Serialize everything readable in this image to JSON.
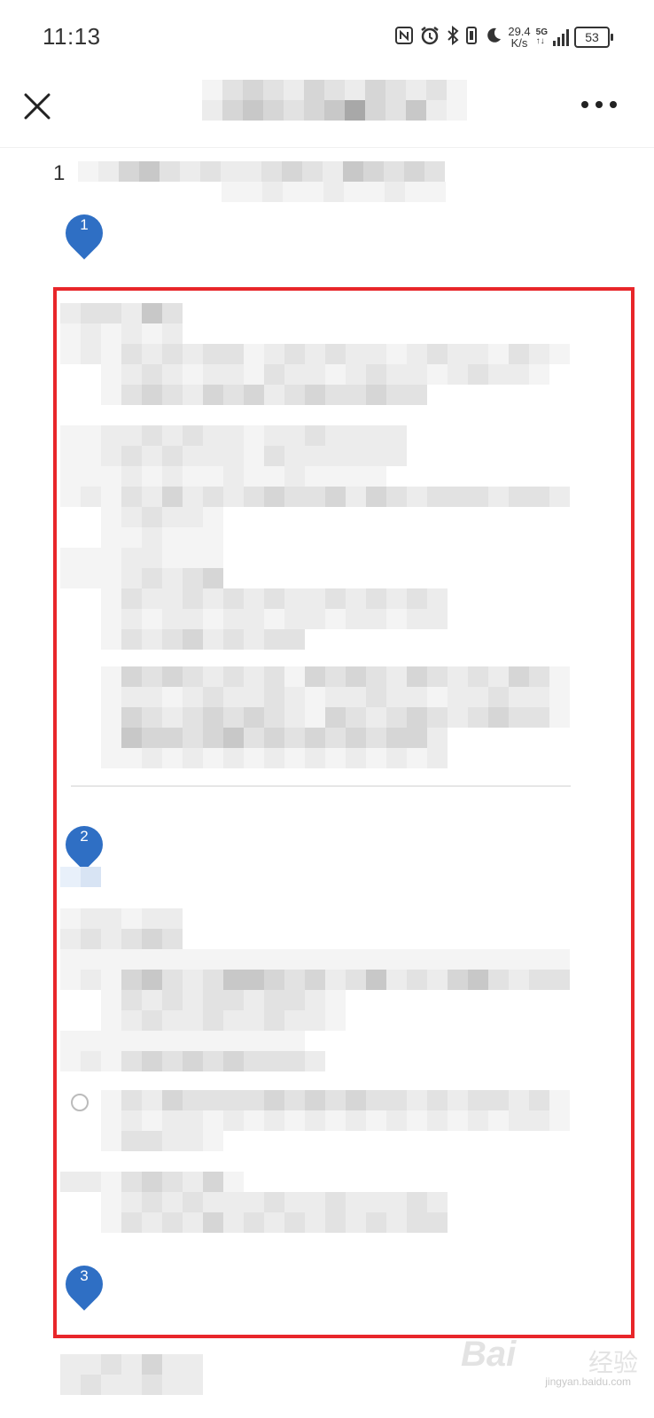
{
  "status_bar": {
    "time": "11:13",
    "nfc_icon": "nfc-icon",
    "alarm_icon": "alarm-icon",
    "bluetooth_icon": "bluetooth-icon",
    "dnd_icon": "moon-icon",
    "speed_value": "29.4",
    "speed_unit": "K/s",
    "network_top": "5G",
    "network_bottom": "↑↓",
    "battery": "53"
  },
  "header": {
    "close_icon": "close-icon",
    "more_icon": "more-icon"
  },
  "content": {
    "first_line_char": "1",
    "pins": [
      "1",
      "2",
      "3"
    ]
  },
  "watermark": {
    "main": "Bai",
    "sub": "经验",
    "domain": "jingyan.baidu.com"
  },
  "colors": {
    "highlight_border": "#e8262a",
    "pin_blue": "#2f6fc4"
  }
}
